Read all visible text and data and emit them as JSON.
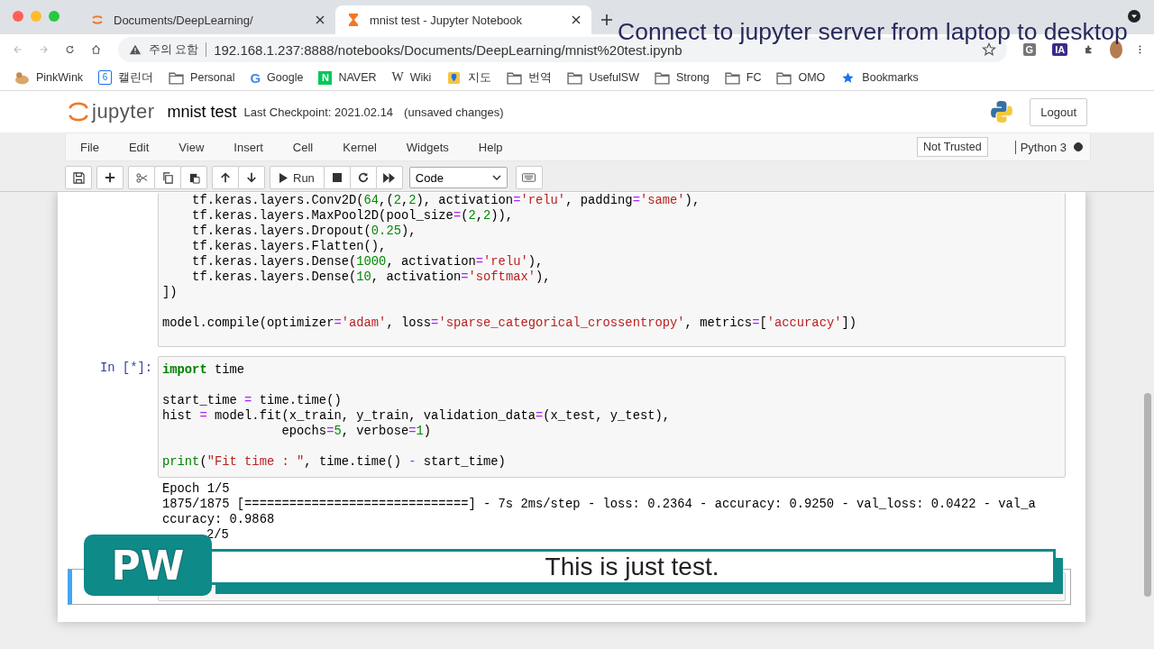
{
  "browser": {
    "tabs": [
      {
        "title": "Documents/DeepLearning/",
        "kind": "jupyter",
        "selected": false
      },
      {
        "title": "mnist test - Jupyter Notebook",
        "kind": "hourglass",
        "selected": true
      }
    ],
    "address": {
      "warning": "주의 요함",
      "url": "192.168.1.237:8888/notebooks/Documents/DeepLearning/mnist%20test.ipynb"
    },
    "extensions": [
      {
        "kind": "grey",
        "text": "G"
      },
      {
        "kind": "purple",
        "text": "IA"
      }
    ],
    "bookmarks": [
      {
        "label": "PinkWink",
        "kind": "pig"
      },
      {
        "label": "캘린더",
        "kind": "calendar",
        "icon_text": "6"
      },
      {
        "label": "Personal",
        "kind": "folder"
      },
      {
        "label": "Google",
        "kind": "google",
        "icon_text": "G"
      },
      {
        "label": "NAVER",
        "kind": "naver",
        "icon_text": "N"
      },
      {
        "label": "Wiki",
        "kind": "wiki",
        "icon_text": "W"
      },
      {
        "label": "지도",
        "kind": "pin"
      },
      {
        "label": "번역",
        "kind": "folder"
      },
      {
        "label": "UsefulSW",
        "kind": "folder"
      },
      {
        "label": "Strong",
        "kind": "folder"
      },
      {
        "label": "FC",
        "kind": "folder"
      },
      {
        "label": "OMO",
        "kind": "folder"
      },
      {
        "label": "Bookmarks",
        "kind": "star"
      }
    ]
  },
  "overlay_title": "Connect to jupyter server from laptop to desktop",
  "jupyter": {
    "logo_text": "jupyter",
    "notebook_name": "mnist test",
    "checkpoint": "Last Checkpoint: 2021.02.14",
    "save_status": "(unsaved changes)",
    "logout": "Logout",
    "menu": [
      "File",
      "Edit",
      "View",
      "Insert",
      "Cell",
      "Kernel",
      "Widgets",
      "Help"
    ],
    "trusted": "Not Trusted",
    "kernel": "Python 3",
    "kernel_busy": true,
    "run_label": "Run",
    "cell_type": "Code"
  },
  "cells": [
    {
      "selected": false,
      "lines": [
        {
          "kind": "code",
          "tokens": [
            {
              "kind": "plain",
              "text": "    tf.keras.layers.Conv2D("
            },
            {
              "kind": "number",
              "text": "64"
            },
            {
              "kind": "plain",
              "text": ",("
            },
            {
              "kind": "number",
              "text": "2"
            },
            {
              "kind": "plain",
              "text": ","
            },
            {
              "kind": "number",
              "text": "2"
            },
            {
              "kind": "plain",
              "text": "), activation"
            },
            {
              "kind": "operator",
              "text": "="
            },
            {
              "kind": "string",
              "text": "'relu'"
            },
            {
              "kind": "plain",
              "text": ", padding"
            },
            {
              "kind": "operator",
              "text": "="
            },
            {
              "kind": "string",
              "text": "'same'"
            },
            {
              "kind": "plain",
              "text": "),"
            }
          ]
        },
        {
          "kind": "code",
          "tokens": [
            {
              "kind": "plain",
              "text": "    tf.keras.layers.MaxPool2D(pool_size"
            },
            {
              "kind": "operator",
              "text": "="
            },
            {
              "kind": "plain",
              "text": "("
            },
            {
              "kind": "number",
              "text": "2"
            },
            {
              "kind": "plain",
              "text": ","
            },
            {
              "kind": "number",
              "text": "2"
            },
            {
              "kind": "plain",
              "text": ")),"
            }
          ]
        },
        {
          "kind": "code",
          "tokens": [
            {
              "kind": "plain",
              "text": "    tf.keras.layers.Dropout("
            },
            {
              "kind": "number",
              "text": "0.25"
            },
            {
              "kind": "plain",
              "text": "),"
            }
          ]
        },
        {
          "kind": "code",
          "tokens": [
            {
              "kind": "plain",
              "text": "    tf.keras.layers.Flatten(),"
            }
          ]
        },
        {
          "kind": "code",
          "tokens": [
            {
              "kind": "plain",
              "text": "    tf.keras.layers.Dense("
            },
            {
              "kind": "number",
              "text": "1000"
            },
            {
              "kind": "plain",
              "text": ", activation"
            },
            {
              "kind": "operator",
              "text": "="
            },
            {
              "kind": "string",
              "text": "'relu'"
            },
            {
              "kind": "plain",
              "text": "),"
            }
          ]
        },
        {
          "kind": "code",
          "tokens": [
            {
              "kind": "plain",
              "text": "    tf.keras.layers.Dense("
            },
            {
              "kind": "number",
              "text": "10"
            },
            {
              "kind": "plain",
              "text": ", activation"
            },
            {
              "kind": "operator",
              "text": "="
            },
            {
              "kind": "string",
              "text": "'softmax'"
            },
            {
              "kind": "plain",
              "text": "),"
            }
          ]
        },
        {
          "kind": "code",
          "tokens": [
            {
              "kind": "plain",
              "text": "])"
            }
          ]
        },
        {
          "kind": "blank"
        },
        {
          "kind": "code",
          "tokens": [
            {
              "kind": "plain",
              "text": "model.compile(optimizer"
            },
            {
              "kind": "operator",
              "text": "="
            },
            {
              "kind": "string",
              "text": "'adam'"
            },
            {
              "kind": "plain",
              "text": ", loss"
            },
            {
              "kind": "operator",
              "text": "="
            },
            {
              "kind": "string",
              "text": "'sparse_categorical_crossentropy'"
            },
            {
              "kind": "plain",
              "text": ", metrics"
            },
            {
              "kind": "operator",
              "text": "="
            },
            {
              "kind": "plain",
              "text": "["
            },
            {
              "kind": "string",
              "text": "'accuracy'"
            },
            {
              "kind": "plain",
              "text": "])"
            }
          ]
        }
      ]
    },
    {
      "selected": false,
      "prompt": "In [*]:",
      "lines": [
        {
          "kind": "code",
          "tokens": [
            {
              "kind": "keyword",
              "text": "import"
            },
            {
              "kind": "plain",
              "text": " time"
            }
          ]
        },
        {
          "kind": "blank"
        },
        {
          "kind": "code",
          "tokens": [
            {
              "kind": "plain",
              "text": "start_time "
            },
            {
              "kind": "operator",
              "text": "="
            },
            {
              "kind": "plain",
              "text": " time.time()"
            }
          ]
        },
        {
          "kind": "code",
          "tokens": [
            {
              "kind": "plain",
              "text": "hist "
            },
            {
              "kind": "operator",
              "text": "="
            },
            {
              "kind": "plain",
              "text": " model.fit(x_train, y_train, validation_data"
            },
            {
              "kind": "operator",
              "text": "="
            },
            {
              "kind": "plain",
              "text": "(x_test, y_test),"
            }
          ]
        },
        {
          "kind": "code",
          "tokens": [
            {
              "kind": "plain",
              "text": "                epochs"
            },
            {
              "kind": "operator",
              "text": "="
            },
            {
              "kind": "number",
              "text": "5"
            },
            {
              "kind": "plain",
              "text": ", verbose"
            },
            {
              "kind": "operator",
              "text": "="
            },
            {
              "kind": "number",
              "text": "1"
            },
            {
              "kind": "plain",
              "text": ")"
            }
          ]
        },
        {
          "kind": "blank"
        },
        {
          "kind": "code",
          "tokens": [
            {
              "kind": "builtin",
              "text": "print"
            },
            {
              "kind": "plain",
              "text": "("
            },
            {
              "kind": "string",
              "text": "\"Fit time : \""
            },
            {
              "kind": "plain",
              "text": ", time.time() "
            },
            {
              "kind": "operator",
              "text": "-"
            },
            {
              "kind": "plain",
              "text": " start_time)"
            }
          ]
        }
      ],
      "output": [
        "Epoch 1/5",
        "1875/1875 [==============================] - 7s 2ms/step - loss: 0.2364 - accuracy: 0.9250 - val_loss: 0.0422 - val_a",
        "ccuracy: 0.9868",
        "2/5"
      ]
    },
    {
      "selected": true
    }
  ],
  "caption": {
    "badge": "PW",
    "text": "This is just test."
  }
}
